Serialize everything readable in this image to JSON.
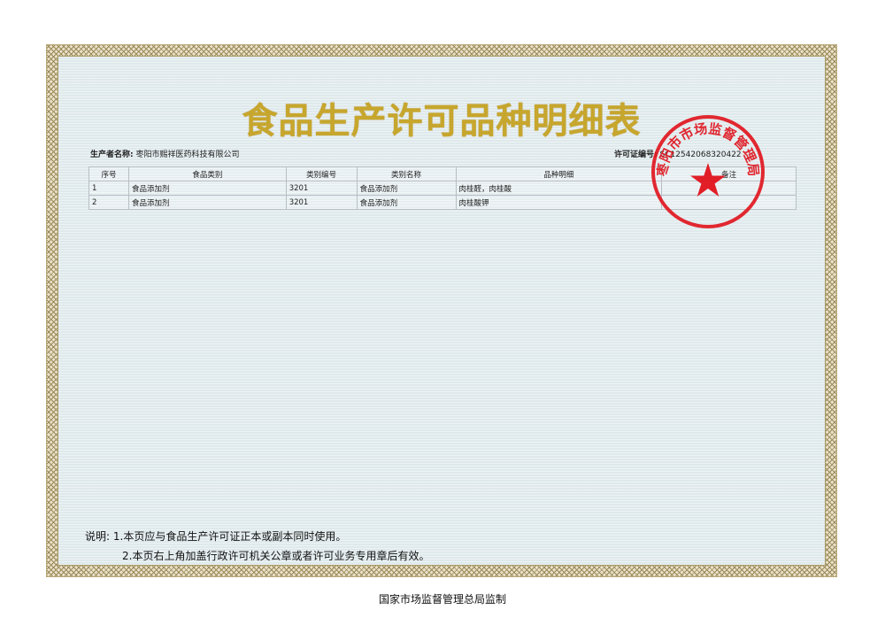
{
  "document": {
    "title": "食品生产许可品种明细表",
    "producer_label": "生产者名称:",
    "producer_name": "枣阳市赐祥医药科技有限公司",
    "license_label": "许可证编号:",
    "license_no": "SC12542068320422"
  },
  "table": {
    "headers": [
      "序号",
      "食品类别",
      "类别编号",
      "类别名称",
      "品种明细",
      "备注"
    ],
    "rows": [
      {
        "no": "1",
        "food_category": "食品添加剂",
        "code": "3201",
        "category_name": "食品添加剂",
        "detail": "肉桂醛，肉桂酸",
        "remark": ""
      },
      {
        "no": "2",
        "food_category": "食品添加剂",
        "code": "3201",
        "category_name": "食品添加剂",
        "detail": "肉桂酸钾",
        "remark": ""
      }
    ]
  },
  "notes": {
    "label": "说明:",
    "line1": "1.本页应与食品生产许可证正本或副本同时使用。",
    "line2": "2.本页右上角加盖行政许可机关公章或者许可业务专用章后有效。"
  },
  "stamp": {
    "text": "枣阳市市场监督管理局",
    "color": "#e0121b"
  },
  "footer": {
    "issuer": "国家市场监督管理总局监制"
  }
}
